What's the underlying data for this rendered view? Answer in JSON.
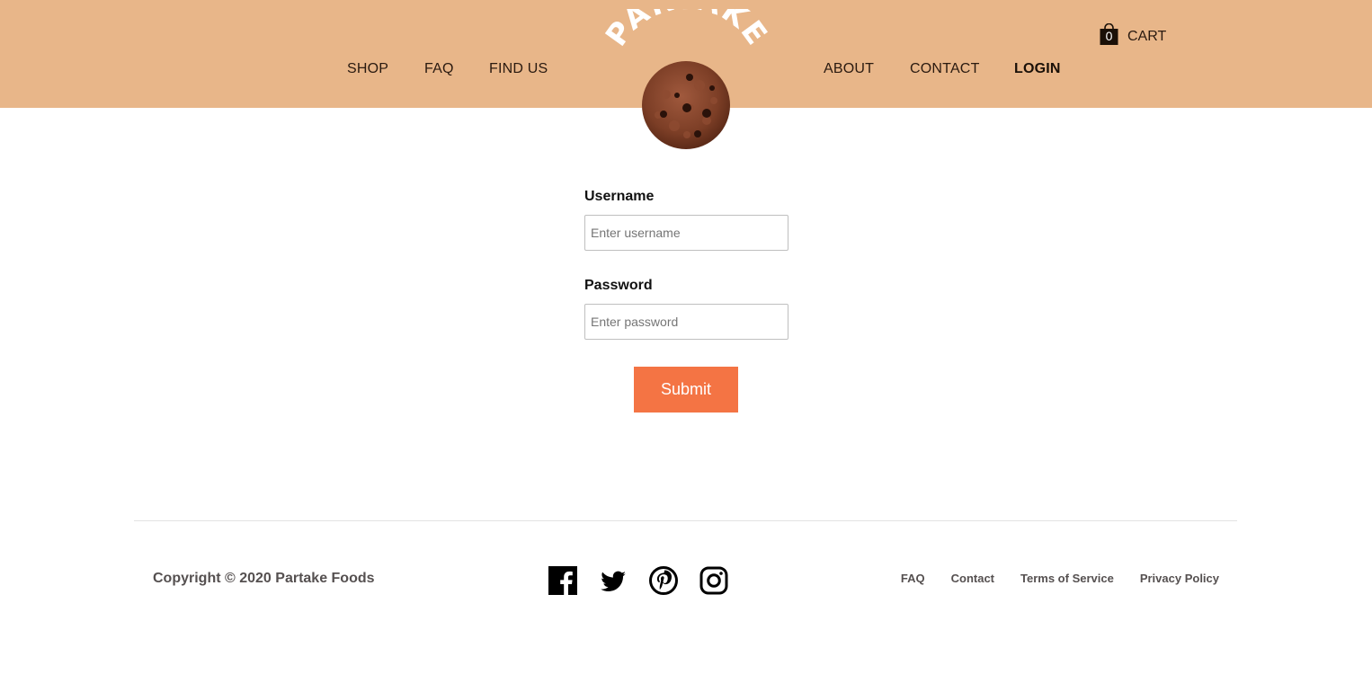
{
  "header": {
    "background": "#e8b689",
    "nav_left": [
      {
        "label": "SHOP"
      },
      {
        "label": "FAQ"
      },
      {
        "label": "FIND US"
      }
    ],
    "nav_right": [
      {
        "label": "ABOUT"
      },
      {
        "label": "CONTACT"
      },
      {
        "label": "LOGIN",
        "active": true
      }
    ],
    "cart": {
      "count": "0",
      "label": "CART",
      "icon": "shopping-bag-icon"
    },
    "logo": {
      "text": "PARTAKE",
      "icon": "cookie-logo"
    }
  },
  "form": {
    "username": {
      "label": "Username",
      "placeholder": "Enter username",
      "value": ""
    },
    "password": {
      "label": "Password",
      "placeholder": "Enter password",
      "value": ""
    },
    "submit_label": "Submit",
    "submit_color": "#f47444"
  },
  "footer": {
    "copyright": "Copyright © 2020 Partake Foods",
    "socials": [
      {
        "icon": "facebook-icon"
      },
      {
        "icon": "twitter-icon"
      },
      {
        "icon": "pinterest-icon"
      },
      {
        "icon": "instagram-icon"
      }
    ],
    "links": [
      {
        "label": "FAQ"
      },
      {
        "label": "Contact"
      },
      {
        "label": "Terms of Service"
      },
      {
        "label": "Privacy Policy"
      }
    ]
  }
}
